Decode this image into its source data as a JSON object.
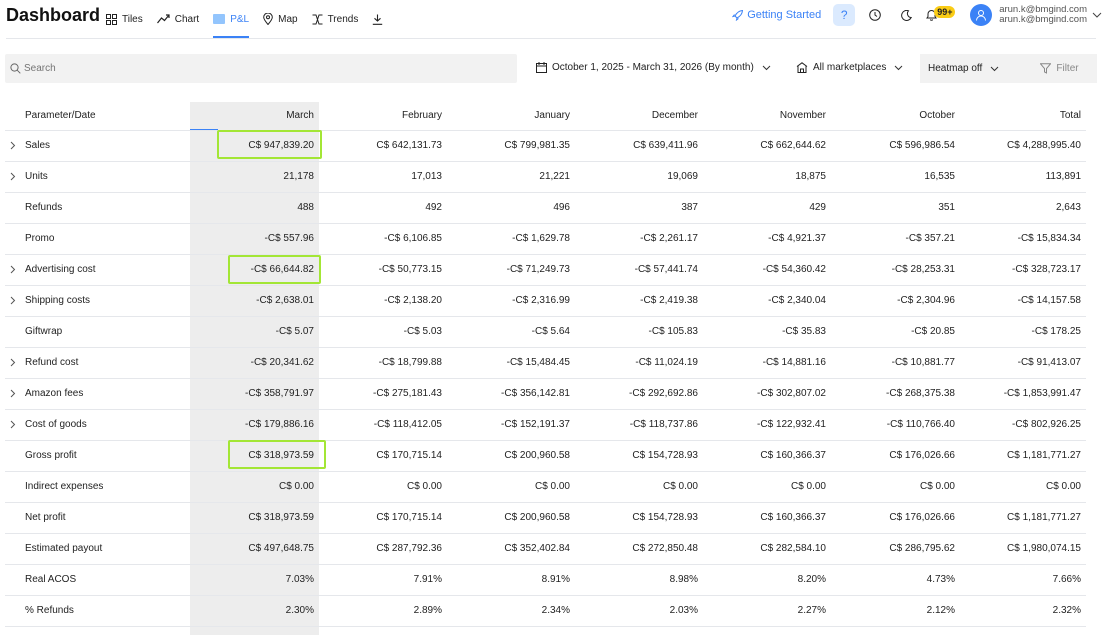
{
  "brand": "Dashboard",
  "nav": [
    {
      "label": "Tiles",
      "icon": "tiles-icon"
    },
    {
      "label": "Chart",
      "icon": "chart-icon"
    },
    {
      "label": "P&L",
      "icon": "pl-icon",
      "active": true
    },
    {
      "label": "Map",
      "icon": "map-pin-icon"
    },
    {
      "label": "Trends",
      "icon": "trends-icon"
    }
  ],
  "header": {
    "getting_started": "Getting Started",
    "help_label": "?",
    "notification_count": "99+",
    "user_email_1": "arun.k@bmgind.com",
    "user_email_2": "arun.k@bmgind.com"
  },
  "filters": {
    "search_placeholder": "Search",
    "date_range": "October 1, 2025 - March 31, 2026 (By month)",
    "marketplaces": "All marketplaces",
    "heatmap": "Heatmap off",
    "filter": "Filter"
  },
  "colors": {
    "accent": "#3b82f6",
    "highlight_box": "#a3e635",
    "badge": "#facc15"
  },
  "table": {
    "columns": [
      "Parameter/Date",
      "March",
      "February",
      "January",
      "December",
      "November",
      "October",
      "Total"
    ],
    "rows": [
      {
        "label": "Sales",
        "expandable": true,
        "values": [
          "C$ 947,839.20",
          "C$ 642,131.73",
          "C$ 799,981.35",
          "C$ 639,411.96",
          "C$ 662,644.62",
          "C$ 596,986.54",
          "C$ 4,288,995.40"
        ]
      },
      {
        "label": "Units",
        "expandable": true,
        "values": [
          "21,178",
          "17,013",
          "21,221",
          "19,069",
          "18,875",
          "16,535",
          "113,891"
        ]
      },
      {
        "label": "Refunds",
        "expandable": false,
        "values": [
          "488",
          "492",
          "496",
          "387",
          "429",
          "351",
          "2,643"
        ]
      },
      {
        "label": "Promo",
        "expandable": false,
        "values": [
          "-C$ 557.96",
          "-C$ 6,106.85",
          "-C$ 1,629.78",
          "-C$ 2,261.17",
          "-C$ 4,921.37",
          "-C$ 357.21",
          "-C$ 15,834.34"
        ]
      },
      {
        "label": "Advertising cost",
        "expandable": true,
        "values": [
          "-C$ 66,644.82",
          "-C$ 50,773.15",
          "-C$ 71,249.73",
          "-C$ 57,441.74",
          "-C$ 54,360.42",
          "-C$ 28,253.31",
          "-C$ 328,723.17"
        ]
      },
      {
        "label": "Shipping costs",
        "expandable": true,
        "values": [
          "-C$ 2,638.01",
          "-C$ 2,138.20",
          "-C$ 2,316.99",
          "-C$ 2,419.38",
          "-C$ 2,340.04",
          "-C$ 2,304.96",
          "-C$ 14,157.58"
        ]
      },
      {
        "label": "Giftwrap",
        "expandable": false,
        "values": [
          "-C$ 5.07",
          "-C$ 5.03",
          "-C$ 5.64",
          "-C$ 105.83",
          "-C$ 35.83",
          "-C$ 20.85",
          "-C$ 178.25"
        ]
      },
      {
        "label": "Refund cost",
        "expandable": true,
        "values": [
          "-C$ 20,341.62",
          "-C$ 18,799.88",
          "-C$ 15,484.45",
          "-C$ 11,024.19",
          "-C$ 14,881.16",
          "-C$ 10,881.77",
          "-C$ 91,413.07"
        ]
      },
      {
        "label": "Amazon fees",
        "expandable": true,
        "values": [
          "-C$ 358,791.97",
          "-C$ 275,181.43",
          "-C$ 356,142.81",
          "-C$ 292,692.86",
          "-C$ 302,807.02",
          "-C$ 268,375.38",
          "-C$ 1,853,991.47"
        ]
      },
      {
        "label": "Cost of goods",
        "expandable": true,
        "values": [
          "-C$ 179,886.16",
          "-C$ 118,412.05",
          "-C$ 152,191.37",
          "-C$ 118,737.86",
          "-C$ 122,932.41",
          "-C$ 110,766.40",
          "-C$ 802,926.25"
        ]
      },
      {
        "label": "Gross profit",
        "expandable": false,
        "values": [
          "C$ 318,973.59",
          "C$ 170,715.14",
          "C$ 200,960.58",
          "C$ 154,728.93",
          "C$ 160,366.37",
          "C$ 176,026.66",
          "C$ 1,181,771.27"
        ]
      },
      {
        "label": "Indirect expenses",
        "expandable": false,
        "values": [
          "C$ 0.00",
          "C$ 0.00",
          "C$ 0.00",
          "C$ 0.00",
          "C$ 0.00",
          "C$ 0.00",
          "C$ 0.00"
        ]
      },
      {
        "label": "Net profit",
        "expandable": false,
        "values": [
          "C$ 318,973.59",
          "C$ 170,715.14",
          "C$ 200,960.58",
          "C$ 154,728.93",
          "C$ 160,366.37",
          "C$ 176,026.66",
          "C$ 1,181,771.27"
        ]
      },
      {
        "label": "Estimated payout",
        "expandable": false,
        "values": [
          "C$ 497,648.75",
          "C$ 287,792.36",
          "C$ 352,402.84",
          "C$ 272,850.48",
          "C$ 282,584.10",
          "C$ 286,795.62",
          "C$ 1,980,074.15"
        ]
      },
      {
        "label": "Real ACOS",
        "expandable": false,
        "values": [
          "7.03%",
          "7.91%",
          "8.91%",
          "8.98%",
          "8.20%",
          "4.73%",
          "7.66%"
        ]
      },
      {
        "label": "% Refunds",
        "expandable": false,
        "values": [
          "2.30%",
          "2.89%",
          "2.34%",
          "2.03%",
          "2.27%",
          "2.12%",
          "2.32%"
        ]
      }
    ]
  }
}
